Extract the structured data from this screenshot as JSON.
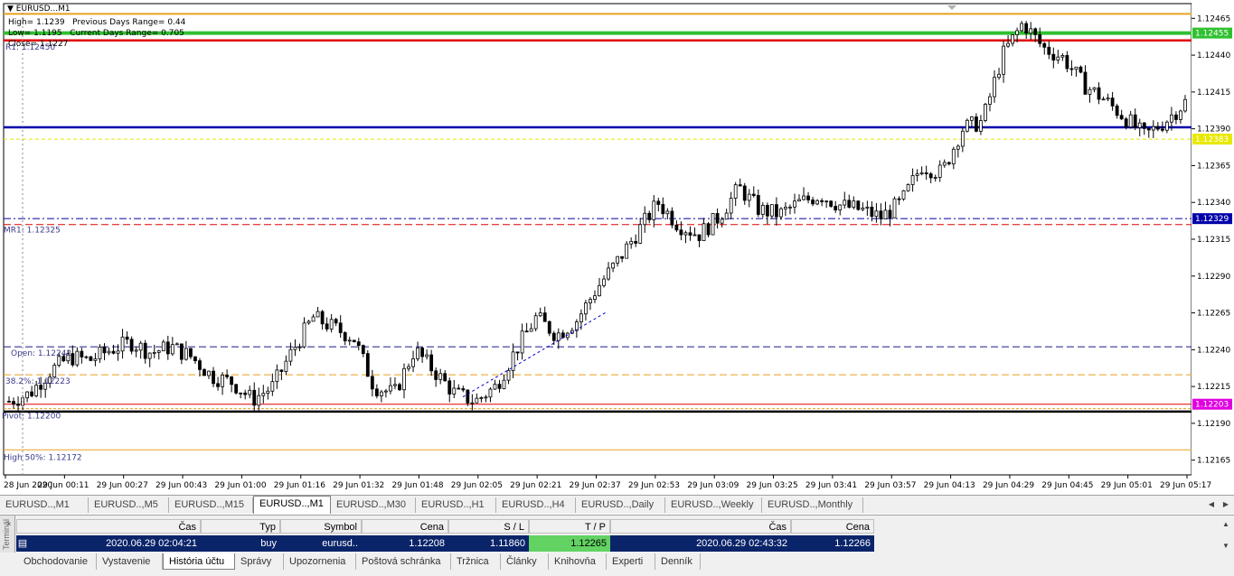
{
  "window": {
    "title": "EURUSD...M1"
  },
  "info_lines": [
    "High= 1.1239",
    "Low= 1.1195",
    "Close= 1.1227"
  ],
  "info_right": [
    "Previous Days Range= 0.44",
    "Current Days Range= 0.705"
  ],
  "colors": {
    "up": "#ffffff",
    "down": "#000000",
    "orange": "#e8a020",
    "green": "#30c030",
    "red": "#e00000",
    "blue": "#0000aa",
    "yellow": "#e8e800",
    "magenta": "#e000e0"
  },
  "chart_data": {
    "type": "candlestick",
    "symbol": "EURUSD",
    "timeframe": "M1",
    "ylim": [
      1.12155,
      1.12475
    ],
    "y_ticks": [
      "1.12465",
      "1.12440",
      "1.12415",
      "1.12390",
      "1.12365",
      "1.12340",
      "1.12315",
      "1.12290",
      "1.12265",
      "1.12240",
      "1.12215",
      "1.12190",
      "1.12165"
    ],
    "x_ticks": [
      "28 Jun 2020",
      "29 Jun 00:11",
      "29 Jun 00:27",
      "29 Jun 00:43",
      "29 Jun 01:00",
      "29 Jun 01:16",
      "29 Jun 01:32",
      "29 Jun 01:48",
      "29 Jun 02:05",
      "29 Jun 02:21",
      "29 Jun 02:37",
      "29 Jun 02:53",
      "29 Jun 03:09",
      "29 Jun 03:25",
      "29 Jun 03:41",
      "29 Jun 03:57",
      "29 Jun 04:13",
      "29 Jun 04:29",
      "29 Jun 04:45",
      "29 Jun 05:01",
      "29 Jun 05:17"
    ],
    "price_labels": [
      {
        "value": "1.12455",
        "bg": "#30c030"
      },
      {
        "value": "1.12383",
        "bg": "#e8e800"
      },
      {
        "value": "1.12329",
        "bg": "#0000aa"
      },
      {
        "value": "1.12203",
        "bg": "#e000e0"
      }
    ],
    "level_labels": [
      "R1: 1.12450",
      "MR1: 1.12325",
      "Open: 1.12242",
      "38.2%: 1.12223",
      "Pivot: 1.12200",
      "High 50%: 1.12172"
    ],
    "close_path": [
      1.12205,
      1.1221,
      1.12225,
      1.12235,
      1.12233,
      1.1224,
      1.12245,
      1.12238,
      1.12242,
      1.12235,
      1.12222,
      1.12218,
      1.12206,
      1.12215,
      1.1224,
      1.12262,
      1.12255,
      1.12248,
      1.12215,
      1.1221,
      1.1224,
      1.12225,
      1.1221,
      1.12205,
      1.12215,
      1.1224,
      1.12262,
      1.1225,
      1.1226,
      1.12282,
      1.123,
      1.1232,
      1.1234,
      1.12325,
      1.12318,
      1.1233,
      1.1235,
      1.12335,
      1.12332,
      1.1234,
      1.12345,
      1.12338,
      1.12335,
      1.1233,
      1.1234,
      1.12365,
      1.1236,
      1.1239,
      1.12395,
      1.1244,
      1.12462,
      1.12445,
      1.12438,
      1.1242,
      1.1241,
      1.12398,
      1.12385,
      1.12395,
      1.12408
    ]
  },
  "timeframe_tabs": [
    "EURUSD..,M1",
    "EURUSD..,M5",
    "EURUSD..,M15",
    "EURUSD..,M1",
    "EURUSD..,M30",
    "EURUSD..,H1",
    "EURUSD..,H4",
    "EURUSD..,Daily",
    "EURUSD..,Weekly",
    "EURUSD..,Monthly"
  ],
  "terminal": {
    "side_label": "Terminál",
    "headers": [
      "Čas",
      "Typ",
      "Symbol",
      "Cena",
      "S / L",
      "T / P",
      "Čas",
      "Cena"
    ],
    "row": [
      "2020.06.29 02:04:21",
      "buy",
      "eurusd..",
      "1.12208",
      "1.11860",
      "1.12265",
      "2020.06.29 02:43:32",
      "1.12266"
    ],
    "tabs": [
      "Obchodovanie",
      "Vystavenie",
      "História účtu",
      "Správy",
      "Upozornenia",
      "Poštová schránka",
      "Tržnica",
      "Články",
      "Knihovňa",
      "Experti",
      "Denník"
    ]
  }
}
